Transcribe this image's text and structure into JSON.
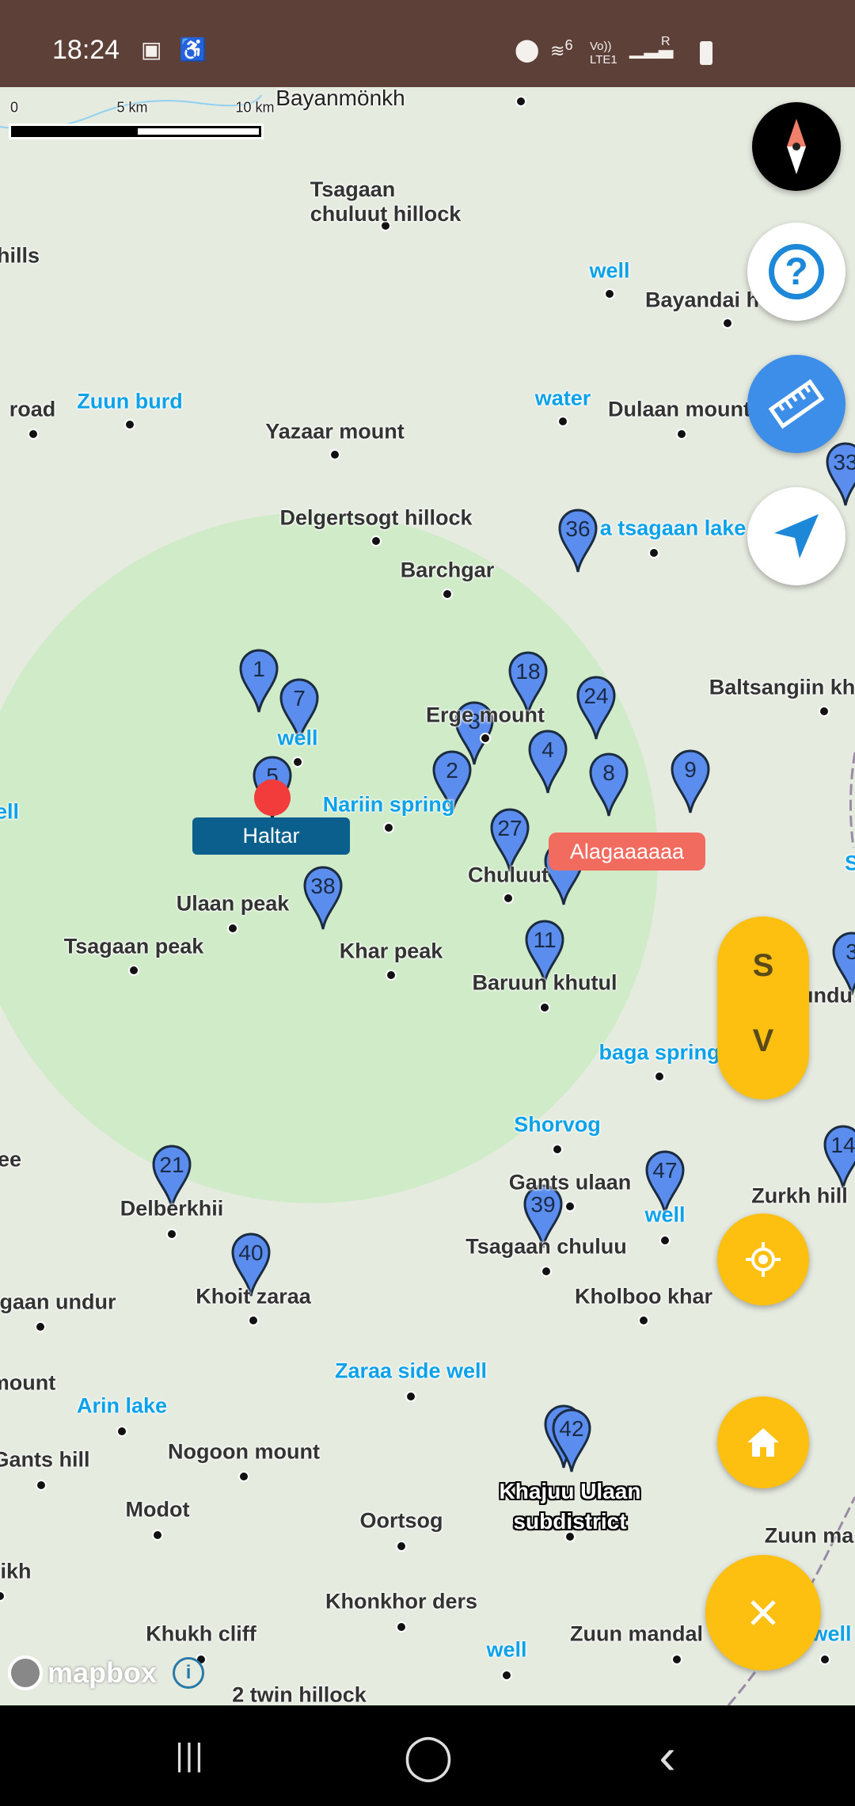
{
  "status_bar": {
    "time": "18:24",
    "icons": [
      "gallery-icon",
      "accessibility-icon",
      "location-icon",
      "wifi-6-icon",
      "volte-lte1-icon",
      "signal-icon",
      "roaming-signal-icon",
      "battery-icon"
    ],
    "volte": "Vo)) LTE1",
    "wifi_badge": "6",
    "roaming": "R"
  },
  "scale_bar": {
    "ticks": [
      "0",
      "5 km",
      "10 km"
    ]
  },
  "map": {
    "labels": [
      {
        "text": "Bayanmönkh",
        "kind": "thin"
      },
      {
        "text": "Tsagaan\nchuluut hillock",
        "kind": "dark"
      },
      {
        "text": "hills",
        "kind": "dark"
      },
      {
        "text": "well",
        "kind": "blue"
      },
      {
        "text": "Bayandai h",
        "kind": "dark"
      },
      {
        "text": "road",
        "kind": "dark"
      },
      {
        "text": "Zuun burd",
        "kind": "blue"
      },
      {
        "text": "water",
        "kind": "blue"
      },
      {
        "text": "Dulaan mount",
        "kind": "dark"
      },
      {
        "text": "Yazaar mount",
        "kind": "dark"
      },
      {
        "text": "Delgertsogt hillock",
        "kind": "dark"
      },
      {
        "text": "a tsagaan lake",
        "kind": "blue"
      },
      {
        "text": "Barchgar",
        "kind": "dark"
      },
      {
        "text": "Baltsangiin kh",
        "kind": "dark"
      },
      {
        "text": "Erge    mount",
        "kind": "dark"
      },
      {
        "text": "well",
        "kind": "blue"
      },
      {
        "text": "ell",
        "kind": "blue"
      },
      {
        "text": "Nariin spring",
        "kind": "blue"
      },
      {
        "text": "Chuluut",
        "kind": "dark"
      },
      {
        "text": "Ulaan peak",
        "kind": "dark"
      },
      {
        "text": "Tsagaan peak",
        "kind": "dark"
      },
      {
        "text": "Khar peak",
        "kind": "dark"
      },
      {
        "text": "Baruun khutul",
        "kind": "dark"
      },
      {
        "text": "n undu",
        "kind": "dark"
      },
      {
        "text": "baga spring",
        "kind": "blue"
      },
      {
        "text": "Shorvog",
        "kind": "blue"
      },
      {
        "text": "ee",
        "kind": "dark"
      },
      {
        "text": "Gants ulaan",
        "kind": "dark"
      },
      {
        "text": "Zurkh hill",
        "kind": "dark"
      },
      {
        "text": "Delberkhii",
        "kind": "dark"
      },
      {
        "text": "well",
        "kind": "blue"
      },
      {
        "text": "Tsagaan chuluu",
        "kind": "dark"
      },
      {
        "text": "gaan undur",
        "kind": "dark"
      },
      {
        "text": "Khoit zaraa",
        "kind": "dark"
      },
      {
        "text": "Kholboo khar",
        "kind": "dark"
      },
      {
        "text": "mount",
        "kind": "dark"
      },
      {
        "text": "Zaraa side well",
        "kind": "blue"
      },
      {
        "text": "Arin lake",
        "kind": "blue"
      },
      {
        "text": "Gants hill",
        "kind": "dark"
      },
      {
        "text": "Nogoon mount",
        "kind": "dark"
      },
      {
        "text": "Khajuu Ulaan\nsubdistrict",
        "kind": "place"
      },
      {
        "text": "Modot",
        "kind": "dark"
      },
      {
        "text": "Oortsog",
        "kind": "dark"
      },
      {
        "text": "Zuun ma",
        "kind": "dark"
      },
      {
        "text": "ikh",
        "kind": "dark"
      },
      {
        "text": "Khonkhor  ders",
        "kind": "dark"
      },
      {
        "text": "Khukh cliff",
        "kind": "dark"
      },
      {
        "text": "Zuun mandal",
        "kind": "dark"
      },
      {
        "text": "well",
        "kind": "blue"
      },
      {
        "text": "well",
        "kind": "blue"
      },
      {
        "text": "2 twin hillock",
        "kind": "dark"
      },
      {
        "text": "S",
        "kind": "blue"
      }
    ],
    "pins": [
      "1",
      "7",
      "5",
      "36",
      "33",
      "18",
      "24",
      "3",
      "4",
      "2",
      "8",
      "9",
      "27",
      "",
      "38",
      "11",
      "3",
      "21",
      "47",
      "39",
      "14",
      "40",
      "10",
      "42"
    ],
    "pin_color": "#5b8def",
    "range_circle_color": "#bfe9b4",
    "markers": [
      {
        "label": "Haltar",
        "color": "#0a5f8c"
      },
      {
        "label": "Alagaaaaaa",
        "color": "#f26b5f"
      }
    ],
    "current_position_color": "#f23b3b",
    "attribution": {
      "logo": "mapbox",
      "info_icon": "info-icon"
    }
  },
  "controls": {
    "compass": "compass-icon",
    "help": "help-icon",
    "ruler": "ruler-icon",
    "navigate": "navigation-arrow-icon",
    "toggle": {
      "top": "S",
      "bottom": "V"
    },
    "locate": "my-location-icon",
    "home": "home-icon",
    "close": "close-icon",
    "accent": "#fdc010",
    "ruler_color": "#3d8ee8"
  },
  "nav_bar": {
    "recents": "|||",
    "home": "◯",
    "back": "‹"
  }
}
